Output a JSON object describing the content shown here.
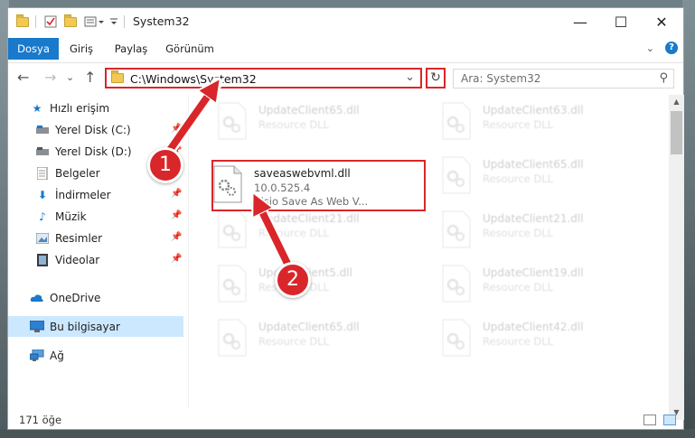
{
  "window": {
    "title": "System32",
    "controls": {
      "minimize": "—",
      "maximize": "☐",
      "close": "✕"
    }
  },
  "ribbon": {
    "tabs": [
      {
        "label": "Dosya",
        "active": true
      },
      {
        "label": "Giriş"
      },
      {
        "label": "Paylaş"
      },
      {
        "label": "Görünüm"
      }
    ],
    "expand_icon": "chevron-down-icon",
    "help_label": "?"
  },
  "address": {
    "path": "C:\\Windows\\System32",
    "search_placeholder": "Ara: System32"
  },
  "nav": {
    "items": [
      {
        "label": "Hızlı erişim",
        "icon": "star-icon"
      },
      {
        "label": "Yerel Disk (C:)",
        "icon": "drive-icon",
        "pinned": true
      },
      {
        "label": "Yerel Disk (D:)",
        "icon": "drive-icon",
        "pinned": true
      },
      {
        "label": "Belgeler",
        "icon": "documents-icon",
        "pinned": true
      },
      {
        "label": "İndirmeler",
        "icon": "download-icon",
        "pinned": true
      },
      {
        "label": "Müzik",
        "icon": "music-icon",
        "pinned": true
      },
      {
        "label": "Resimler",
        "icon": "pictures-icon",
        "pinned": true
      },
      {
        "label": "Videolar",
        "icon": "video-icon",
        "pinned": true
      },
      {
        "label": "OneDrive",
        "icon": "cloud-icon"
      },
      {
        "label": "Bu bilgisayar",
        "icon": "computer-icon",
        "selected": true
      },
      {
        "label": "Ağ",
        "icon": "network-icon"
      }
    ]
  },
  "files": {
    "highlighted": {
      "name": "saveaswebvml.dll",
      "version": "10.0.525.4",
      "description": "Visio Save As Web V..."
    },
    "background": [
      {
        "name": "UpdateClient65.dll",
        "type": "Resource DLL"
      },
      {
        "name": "UpdateClient63.dll",
        "type": "Resource DLL"
      },
      {
        "name": "UpdateClient65.dll",
        "type": "Resource DLL"
      },
      {
        "name": "UpdateClient21.dll",
        "type": "Resource DLL"
      },
      {
        "name": "UpdateClient21.dll",
        "type": "Resource DLL"
      },
      {
        "name": "UpdateClient5.dll",
        "type": "Resource DLL"
      },
      {
        "name": "UpdateClient19.dll",
        "type": "Resource DLL"
      },
      {
        "name": "UpdateClient65.dll",
        "type": "Resource DLL"
      },
      {
        "name": "UpdateClient42.dll",
        "type": "Resource DLL"
      }
    ]
  },
  "status": {
    "item_count": "171 öğe"
  },
  "callouts": {
    "one": "1",
    "two": "2"
  },
  "colors": {
    "accent": "#1979ca",
    "callout": "#d9262a",
    "selected": "#cce8ff"
  }
}
